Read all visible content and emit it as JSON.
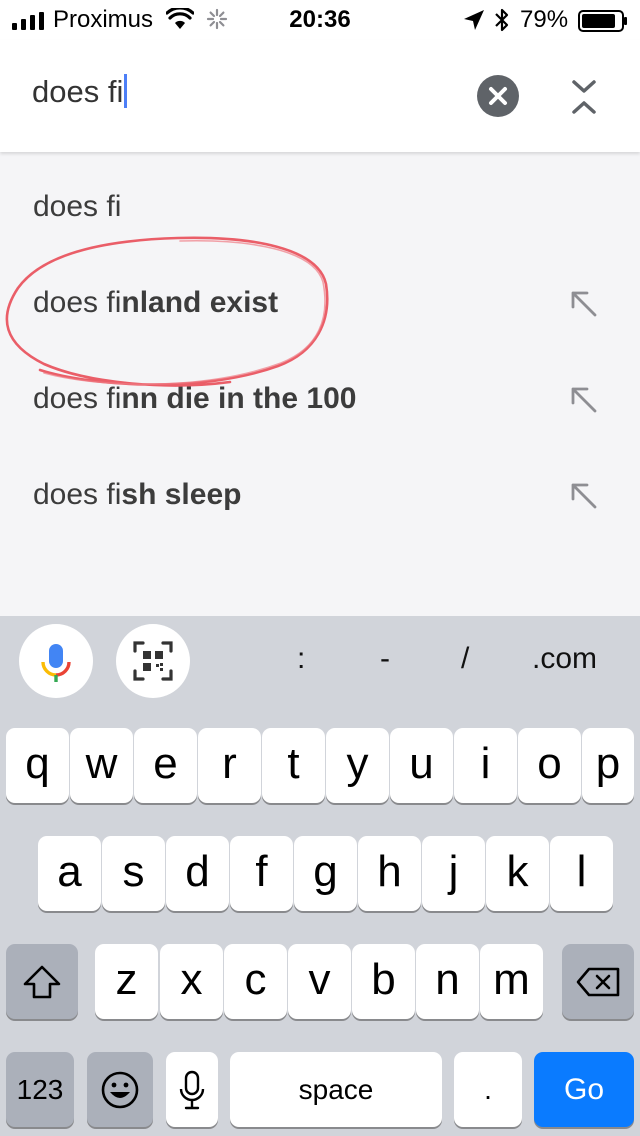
{
  "status_bar": {
    "carrier": "Proximus",
    "time": "20:36",
    "battery": "79%"
  },
  "search": {
    "value": "does fi"
  },
  "suggestions": [
    {
      "prefix": "does fi",
      "suffix": "",
      "has_arrow": false
    },
    {
      "prefix": "does fi",
      "suffix": "nland exist",
      "has_arrow": true
    },
    {
      "prefix": "does fi",
      "suffix": "nn die in the 100",
      "has_arrow": true
    },
    {
      "prefix": "does fi",
      "suffix": "sh sleep",
      "has_arrow": true
    }
  ],
  "keyboard": {
    "quick_keys": [
      ":",
      "-",
      "/",
      ".com"
    ],
    "row1": [
      "q",
      "w",
      "e",
      "r",
      "t",
      "y",
      "u",
      "i",
      "o",
      "p"
    ],
    "row2": [
      "a",
      "s",
      "d",
      "f",
      "g",
      "h",
      "j",
      "k",
      "l"
    ],
    "row3": [
      "z",
      "x",
      "c",
      "v",
      "b",
      "n",
      "m"
    ],
    "numbers_label": "123",
    "space_label": "space",
    "period_label": ".",
    "go_label": "Go"
  },
  "colors": {
    "go_key": "#0a7bff",
    "annotation": "#e8434f",
    "caret": "#4d7ff7"
  }
}
